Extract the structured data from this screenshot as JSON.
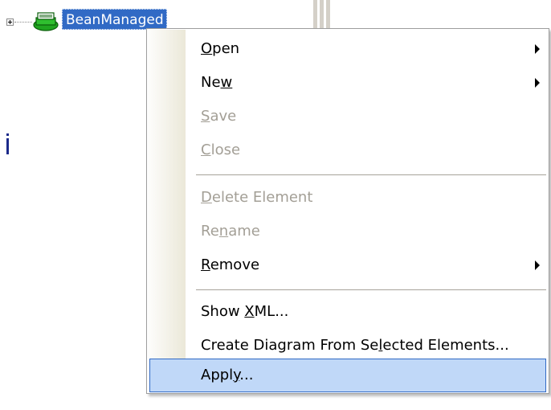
{
  "tree": {
    "node_label": "BeanManaged"
  },
  "menu": {
    "open": {
      "pre": "",
      "mn": "O",
      "post": "pen"
    },
    "new": {
      "pre": "Ne",
      "mn": "w",
      "post": ""
    },
    "save": {
      "pre": "",
      "mn": "S",
      "post": "ave"
    },
    "close": {
      "pre": "",
      "mn": "C",
      "post": "lose"
    },
    "delete_element": {
      "pre": "",
      "mn": "D",
      "post": "elete Element"
    },
    "rename": {
      "pre": "Re",
      "mn": "n",
      "post": "ame"
    },
    "remove": {
      "pre": "",
      "mn": "R",
      "post": "emove"
    },
    "show_xml": {
      "pre": "Show ",
      "mn": "X",
      "post": "ML..."
    },
    "create_diagram": {
      "pre": "Create Diagram From Se",
      "mn": "l",
      "post": "ected Elements..."
    },
    "apply": {
      "pre": "Appl",
      "mn": "y",
      "post": "..."
    }
  },
  "colors": {
    "selection": "#316ac5",
    "highlight_fill": "#c0d8f8",
    "disabled_text": "#a39f96",
    "node_icon_green": "#1fa51f"
  }
}
